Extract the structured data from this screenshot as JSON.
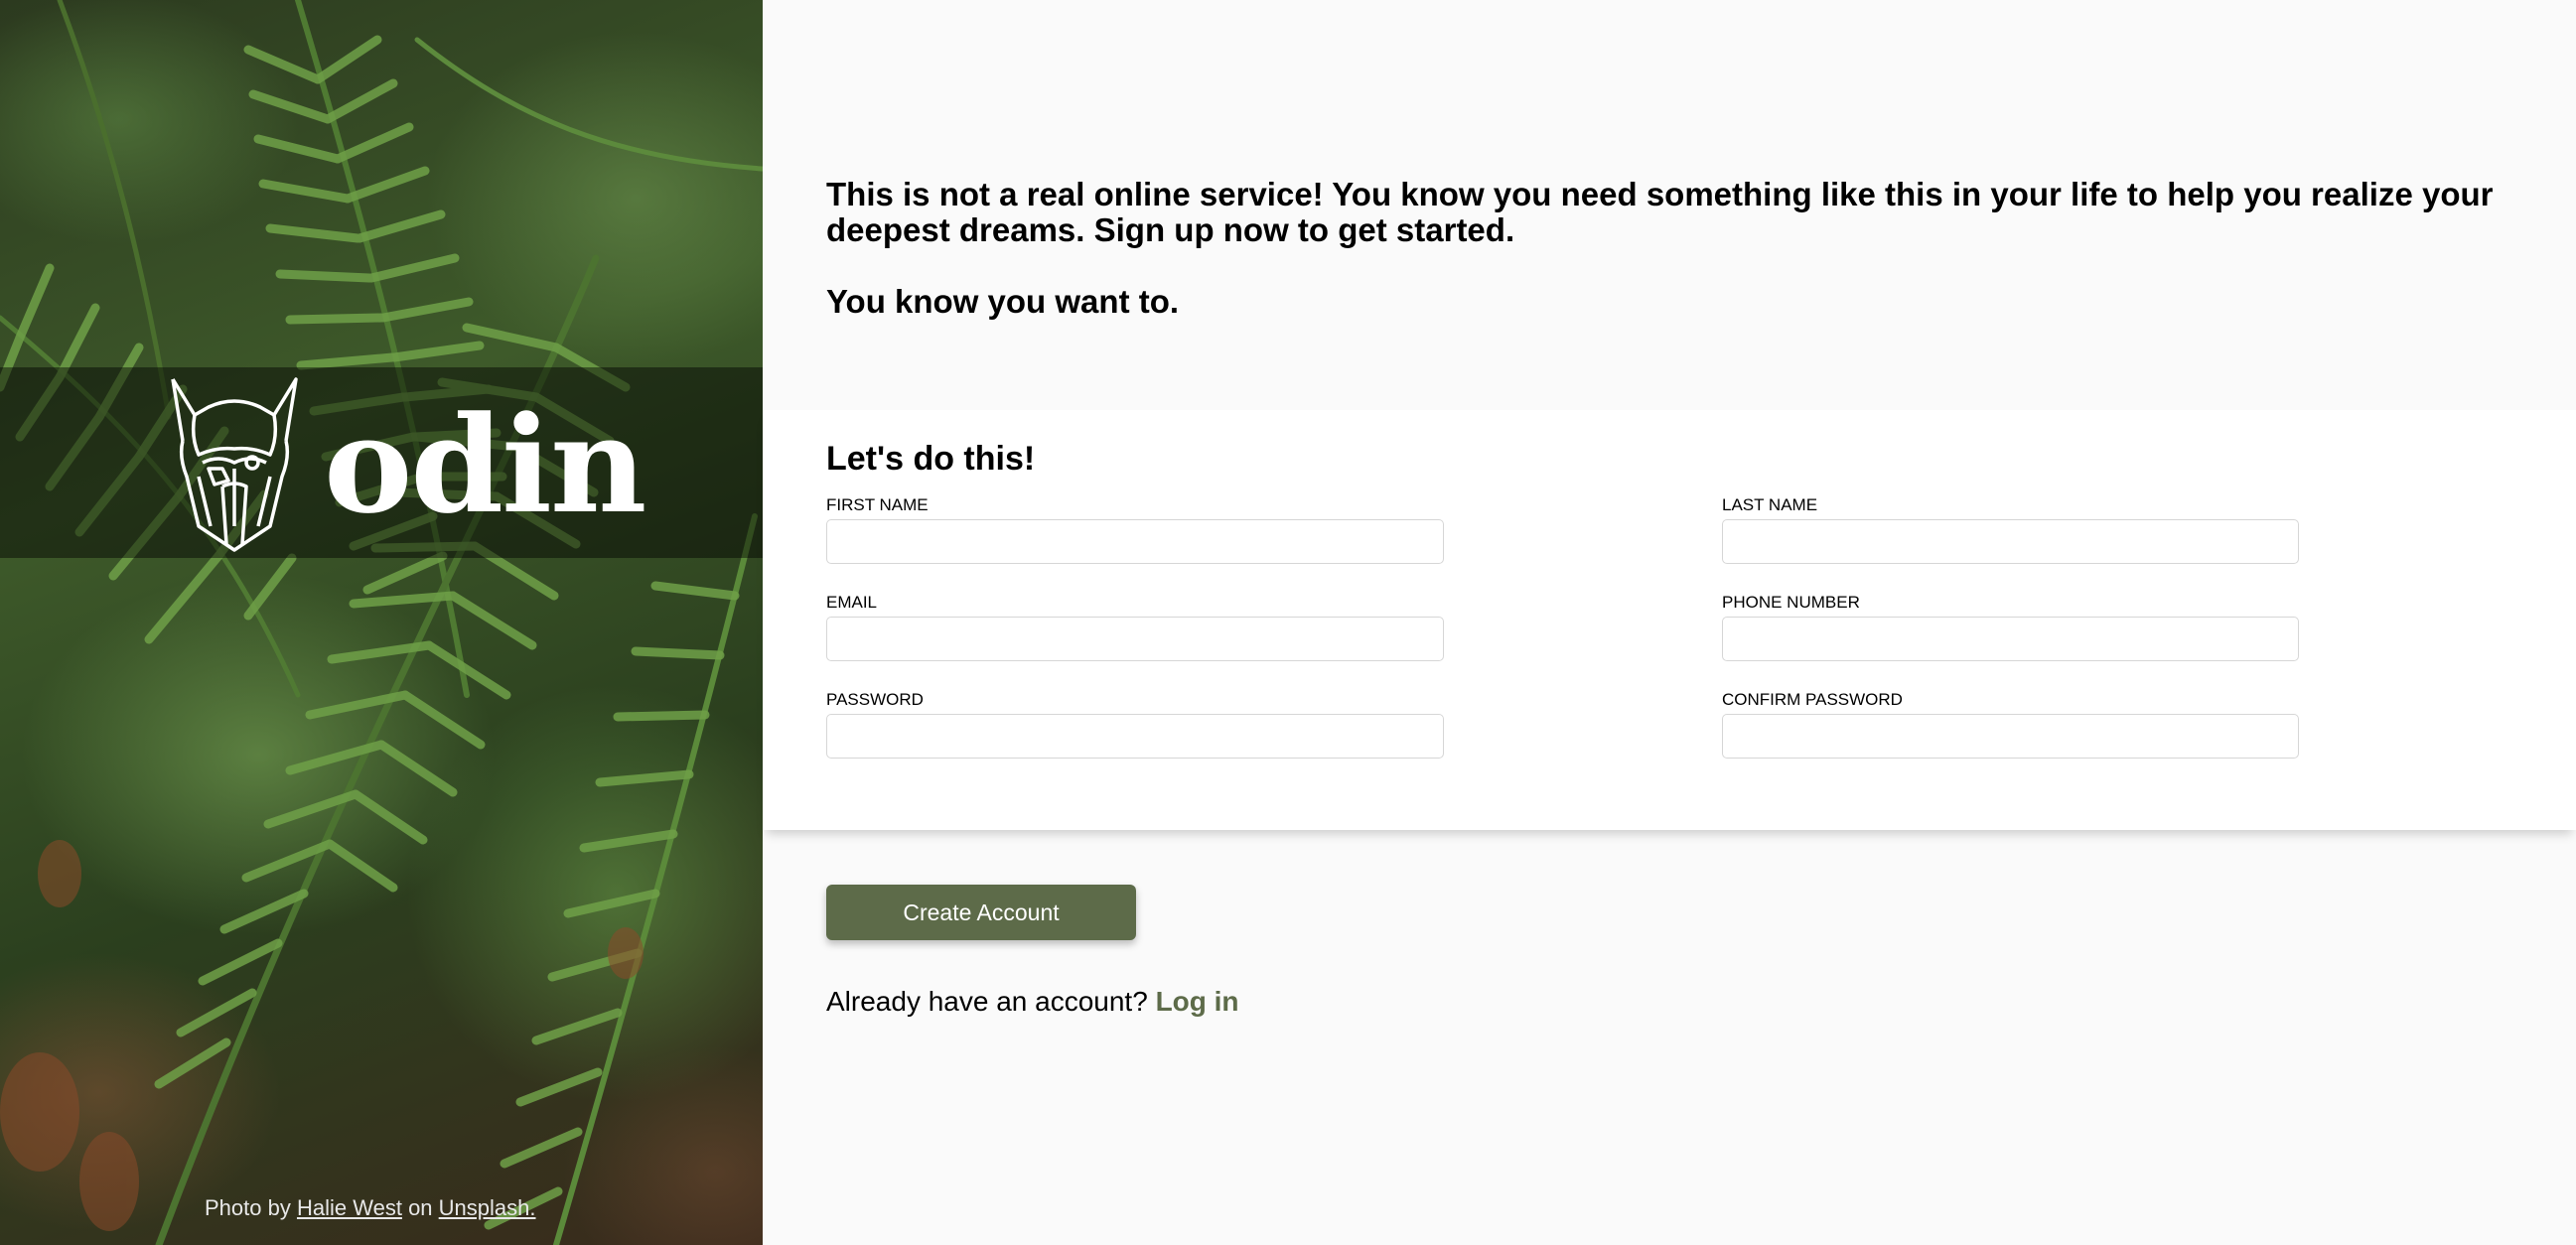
{
  "brand": {
    "name": "odin"
  },
  "credit": {
    "prefix": "Photo by",
    "author": "Halie West",
    "middle": "on",
    "source": "Unsplash."
  },
  "intro": {
    "line1": "This is not a real online service! You know you need something like this in your life to help you realize your deepest dreams. Sign up now to get started.",
    "line2": "You know you want to."
  },
  "form": {
    "title": "Let's do this!",
    "first_name_label": "FIRST NAME",
    "last_name_label": "LAST NAME",
    "email_label": "EMAIL",
    "phone_label": "PHONE NUMBER",
    "password_label": "PASSWORD",
    "confirm_password_label": "CONFIRM PASSWORD"
  },
  "actions": {
    "create_label": "Create Account",
    "login_prompt": "Already have an account?",
    "login_link": "Log in"
  },
  "colors": {
    "accent": "#5d6b49",
    "panel_overlay": "rgba(0,0,0,0.45)"
  },
  "icons": {
    "logo": "viking-helmet-logo-icon"
  }
}
